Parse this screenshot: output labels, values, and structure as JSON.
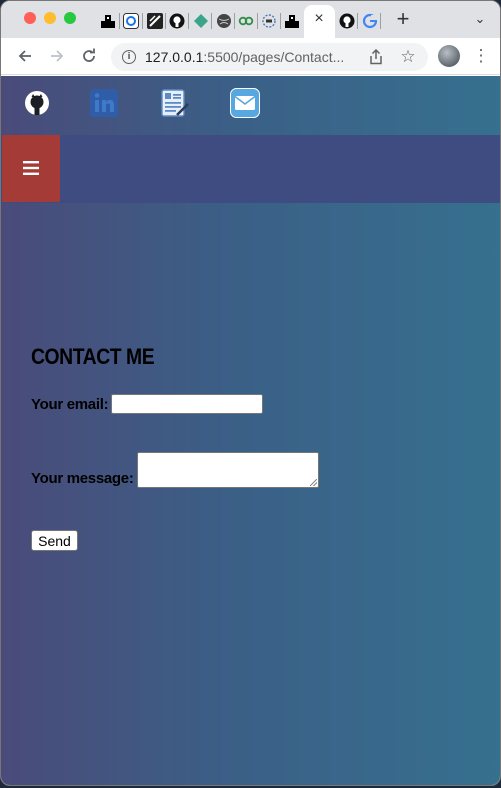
{
  "browser": {
    "url_host": "127.0.0.1",
    "url_rest": ":5500/pages/Contact...",
    "tab_icons": [
      "profile-icon",
      "app-icon",
      "linear-icon",
      "github-icon",
      "diamond-icon",
      "globe-icon",
      "link-icon",
      "tools-icon",
      "profile-icon"
    ],
    "active_tab_close": "×",
    "new_tab": "+",
    "tab_menu": "⌄"
  },
  "social": {
    "links": [
      "github-icon",
      "linkedin-icon",
      "resume-icon",
      "mail-icon"
    ]
  },
  "nav": {
    "menu_glyph": "≡"
  },
  "contact": {
    "title": "CONTACT ME",
    "email_label": "Your email:",
    "email_value": "",
    "message_label": "Your message:",
    "message_value": "",
    "send_label": "Send"
  },
  "colors": {
    "hamburger_bg": "#a43b36",
    "navbar_bg": "#3e4c81",
    "page_gradient_start": "#4a4b7a",
    "page_gradient_end": "#36708f"
  }
}
